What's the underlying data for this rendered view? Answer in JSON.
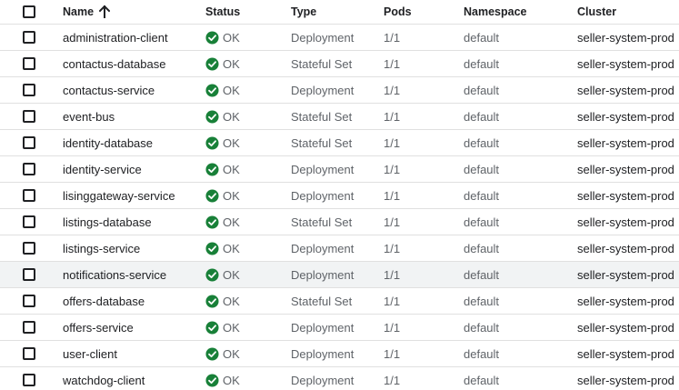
{
  "header": {
    "name": "Name",
    "status": "Status",
    "type": "Type",
    "pods": "Pods",
    "namespace": "Namespace",
    "cluster": "Cluster",
    "sort_icon": "arrow-upward-icon"
  },
  "status_icon": "check-circle-icon",
  "colors": {
    "ok_green": "#188038",
    "row_hover": "#f1f3f4",
    "divider": "#e0e0e0"
  },
  "rows": [
    {
      "name": "administration-client",
      "status": "OK",
      "type": "Deployment",
      "pods": "1/1",
      "namespace": "default",
      "cluster": "seller-system-prod"
    },
    {
      "name": "contactus-database",
      "status": "OK",
      "type": "Stateful Set",
      "pods": "1/1",
      "namespace": "default",
      "cluster": "seller-system-prod"
    },
    {
      "name": "contactus-service",
      "status": "OK",
      "type": "Deployment",
      "pods": "1/1",
      "namespace": "default",
      "cluster": "seller-system-prod"
    },
    {
      "name": "event-bus",
      "status": "OK",
      "type": "Stateful Set",
      "pods": "1/1",
      "namespace": "default",
      "cluster": "seller-system-prod"
    },
    {
      "name": "identity-database",
      "status": "OK",
      "type": "Stateful Set",
      "pods": "1/1",
      "namespace": "default",
      "cluster": "seller-system-prod"
    },
    {
      "name": "identity-service",
      "status": "OK",
      "type": "Deployment",
      "pods": "1/1",
      "namespace": "default",
      "cluster": "seller-system-prod"
    },
    {
      "name": "lisinggateway-service",
      "status": "OK",
      "type": "Deployment",
      "pods": "1/1",
      "namespace": "default",
      "cluster": "seller-system-prod"
    },
    {
      "name": "listings-database",
      "status": "OK",
      "type": "Stateful Set",
      "pods": "1/1",
      "namespace": "default",
      "cluster": "seller-system-prod"
    },
    {
      "name": "listings-service",
      "status": "OK",
      "type": "Deployment",
      "pods": "1/1",
      "namespace": "default",
      "cluster": "seller-system-prod"
    },
    {
      "name": "notifications-service",
      "status": "OK",
      "type": "Deployment",
      "pods": "1/1",
      "namespace": "default",
      "cluster": "seller-system-prod"
    },
    {
      "name": "offers-database",
      "status": "OK",
      "type": "Stateful Set",
      "pods": "1/1",
      "namespace": "default",
      "cluster": "seller-system-prod"
    },
    {
      "name": "offers-service",
      "status": "OK",
      "type": "Deployment",
      "pods": "1/1",
      "namespace": "default",
      "cluster": "seller-system-prod"
    },
    {
      "name": "user-client",
      "status": "OK",
      "type": "Deployment",
      "pods": "1/1",
      "namespace": "default",
      "cluster": "seller-system-prod"
    },
    {
      "name": "watchdog-client",
      "status": "OK",
      "type": "Deployment",
      "pods": "1/1",
      "namespace": "default",
      "cluster": "seller-system-prod"
    }
  ]
}
